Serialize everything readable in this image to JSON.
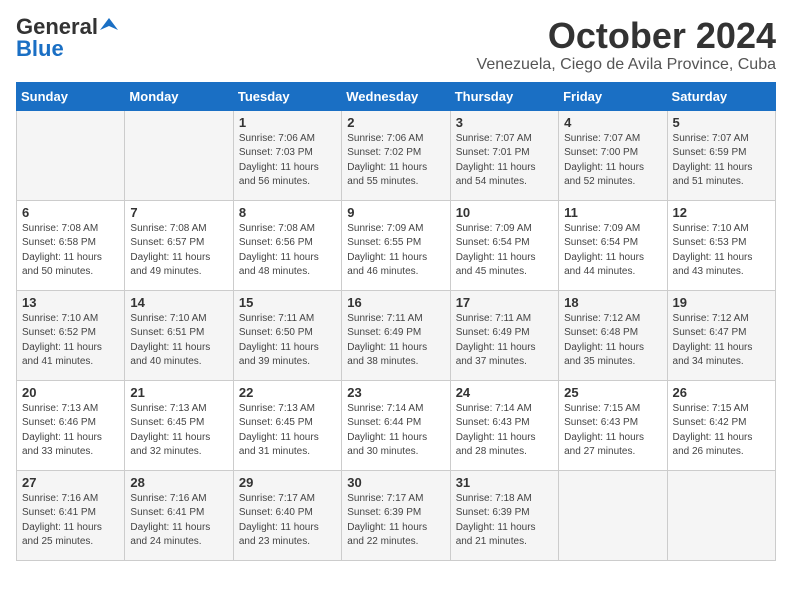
{
  "logo": {
    "general": "General",
    "blue": "Blue"
  },
  "header": {
    "month": "October 2024",
    "location": "Venezuela, Ciego de Avila Province, Cuba"
  },
  "days_of_week": [
    "Sunday",
    "Monday",
    "Tuesday",
    "Wednesday",
    "Thursday",
    "Friday",
    "Saturday"
  ],
  "weeks": [
    [
      {
        "day": "",
        "sunrise": "",
        "sunset": "",
        "daylight": ""
      },
      {
        "day": "",
        "sunrise": "",
        "sunset": "",
        "daylight": ""
      },
      {
        "day": "1",
        "sunrise": "Sunrise: 7:06 AM",
        "sunset": "Sunset: 7:03 PM",
        "daylight": "Daylight: 11 hours and 56 minutes."
      },
      {
        "day": "2",
        "sunrise": "Sunrise: 7:06 AM",
        "sunset": "Sunset: 7:02 PM",
        "daylight": "Daylight: 11 hours and 55 minutes."
      },
      {
        "day": "3",
        "sunrise": "Sunrise: 7:07 AM",
        "sunset": "Sunset: 7:01 PM",
        "daylight": "Daylight: 11 hours and 54 minutes."
      },
      {
        "day": "4",
        "sunrise": "Sunrise: 7:07 AM",
        "sunset": "Sunset: 7:00 PM",
        "daylight": "Daylight: 11 hours and 52 minutes."
      },
      {
        "day": "5",
        "sunrise": "Sunrise: 7:07 AM",
        "sunset": "Sunset: 6:59 PM",
        "daylight": "Daylight: 11 hours and 51 minutes."
      }
    ],
    [
      {
        "day": "6",
        "sunrise": "Sunrise: 7:08 AM",
        "sunset": "Sunset: 6:58 PM",
        "daylight": "Daylight: 11 hours and 50 minutes."
      },
      {
        "day": "7",
        "sunrise": "Sunrise: 7:08 AM",
        "sunset": "Sunset: 6:57 PM",
        "daylight": "Daylight: 11 hours and 49 minutes."
      },
      {
        "day": "8",
        "sunrise": "Sunrise: 7:08 AM",
        "sunset": "Sunset: 6:56 PM",
        "daylight": "Daylight: 11 hours and 48 minutes."
      },
      {
        "day": "9",
        "sunrise": "Sunrise: 7:09 AM",
        "sunset": "Sunset: 6:55 PM",
        "daylight": "Daylight: 11 hours and 46 minutes."
      },
      {
        "day": "10",
        "sunrise": "Sunrise: 7:09 AM",
        "sunset": "Sunset: 6:54 PM",
        "daylight": "Daylight: 11 hours and 45 minutes."
      },
      {
        "day": "11",
        "sunrise": "Sunrise: 7:09 AM",
        "sunset": "Sunset: 6:54 PM",
        "daylight": "Daylight: 11 hours and 44 minutes."
      },
      {
        "day": "12",
        "sunrise": "Sunrise: 7:10 AM",
        "sunset": "Sunset: 6:53 PM",
        "daylight": "Daylight: 11 hours and 43 minutes."
      }
    ],
    [
      {
        "day": "13",
        "sunrise": "Sunrise: 7:10 AM",
        "sunset": "Sunset: 6:52 PM",
        "daylight": "Daylight: 11 hours and 41 minutes."
      },
      {
        "day": "14",
        "sunrise": "Sunrise: 7:10 AM",
        "sunset": "Sunset: 6:51 PM",
        "daylight": "Daylight: 11 hours and 40 minutes."
      },
      {
        "day": "15",
        "sunrise": "Sunrise: 7:11 AM",
        "sunset": "Sunset: 6:50 PM",
        "daylight": "Daylight: 11 hours and 39 minutes."
      },
      {
        "day": "16",
        "sunrise": "Sunrise: 7:11 AM",
        "sunset": "Sunset: 6:49 PM",
        "daylight": "Daylight: 11 hours and 38 minutes."
      },
      {
        "day": "17",
        "sunrise": "Sunrise: 7:11 AM",
        "sunset": "Sunset: 6:49 PM",
        "daylight": "Daylight: 11 hours and 37 minutes."
      },
      {
        "day": "18",
        "sunrise": "Sunrise: 7:12 AM",
        "sunset": "Sunset: 6:48 PM",
        "daylight": "Daylight: 11 hours and 35 minutes."
      },
      {
        "day": "19",
        "sunrise": "Sunrise: 7:12 AM",
        "sunset": "Sunset: 6:47 PM",
        "daylight": "Daylight: 11 hours and 34 minutes."
      }
    ],
    [
      {
        "day": "20",
        "sunrise": "Sunrise: 7:13 AM",
        "sunset": "Sunset: 6:46 PM",
        "daylight": "Daylight: 11 hours and 33 minutes."
      },
      {
        "day": "21",
        "sunrise": "Sunrise: 7:13 AM",
        "sunset": "Sunset: 6:45 PM",
        "daylight": "Daylight: 11 hours and 32 minutes."
      },
      {
        "day": "22",
        "sunrise": "Sunrise: 7:13 AM",
        "sunset": "Sunset: 6:45 PM",
        "daylight": "Daylight: 11 hours and 31 minutes."
      },
      {
        "day": "23",
        "sunrise": "Sunrise: 7:14 AM",
        "sunset": "Sunset: 6:44 PM",
        "daylight": "Daylight: 11 hours and 30 minutes."
      },
      {
        "day": "24",
        "sunrise": "Sunrise: 7:14 AM",
        "sunset": "Sunset: 6:43 PM",
        "daylight": "Daylight: 11 hours and 28 minutes."
      },
      {
        "day": "25",
        "sunrise": "Sunrise: 7:15 AM",
        "sunset": "Sunset: 6:43 PM",
        "daylight": "Daylight: 11 hours and 27 minutes."
      },
      {
        "day": "26",
        "sunrise": "Sunrise: 7:15 AM",
        "sunset": "Sunset: 6:42 PM",
        "daylight": "Daylight: 11 hours and 26 minutes."
      }
    ],
    [
      {
        "day": "27",
        "sunrise": "Sunrise: 7:16 AM",
        "sunset": "Sunset: 6:41 PM",
        "daylight": "Daylight: 11 hours and 25 minutes."
      },
      {
        "day": "28",
        "sunrise": "Sunrise: 7:16 AM",
        "sunset": "Sunset: 6:41 PM",
        "daylight": "Daylight: 11 hours and 24 minutes."
      },
      {
        "day": "29",
        "sunrise": "Sunrise: 7:17 AM",
        "sunset": "Sunset: 6:40 PM",
        "daylight": "Daylight: 11 hours and 23 minutes."
      },
      {
        "day": "30",
        "sunrise": "Sunrise: 7:17 AM",
        "sunset": "Sunset: 6:39 PM",
        "daylight": "Daylight: 11 hours and 22 minutes."
      },
      {
        "day": "31",
        "sunrise": "Sunrise: 7:18 AM",
        "sunset": "Sunset: 6:39 PM",
        "daylight": "Daylight: 11 hours and 21 minutes."
      },
      {
        "day": "",
        "sunrise": "",
        "sunset": "",
        "daylight": ""
      },
      {
        "day": "",
        "sunrise": "",
        "sunset": "",
        "daylight": ""
      }
    ]
  ]
}
